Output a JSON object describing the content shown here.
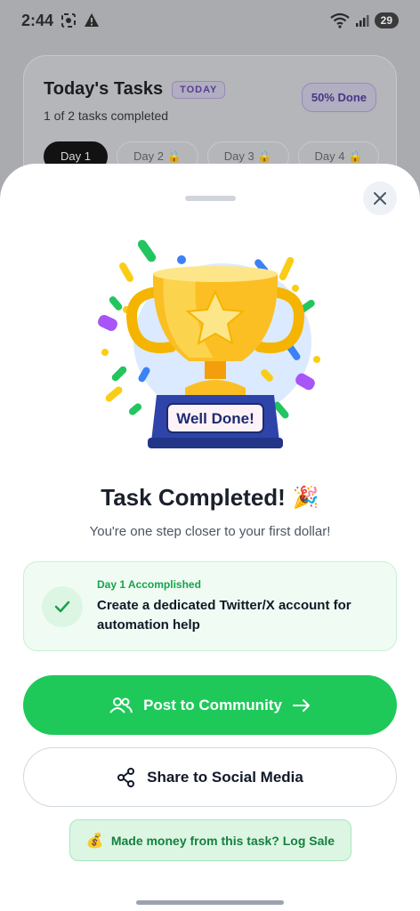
{
  "status_bar": {
    "time": "2:44",
    "battery": "29"
  },
  "background_card": {
    "title": "Today's Tasks",
    "badge": "TODAY",
    "subtitle": "1 of 2 tasks completed",
    "progress_label": "50% Done",
    "days": [
      "Day 1",
      "Day 2 🔒",
      "Day 3 🔒",
      "Day 4 🔒"
    ]
  },
  "sheet": {
    "trophy_plaque": "Well Done!",
    "title": "Task Completed!",
    "title_emoji": "🎉",
    "subtitle": "You're one step closer to your first dollar!",
    "accomplishment": {
      "label": "Day 1 Accomplished",
      "text": "Create a dedicated Twitter/X account for automation help"
    },
    "primary_button": "Post to Community",
    "secondary_button": "Share to Social Media",
    "log_button": "Made money from this task? Log Sale",
    "log_emoji": "💰"
  },
  "icons": {
    "close": "close-icon",
    "check": "check-icon",
    "community": "users-icon",
    "arrow": "arrow-right-icon",
    "share": "share-icon"
  },
  "colors": {
    "accent_green": "#1ec95a",
    "success_text": "#16a34a",
    "badge_purple": "#5a3d91"
  }
}
